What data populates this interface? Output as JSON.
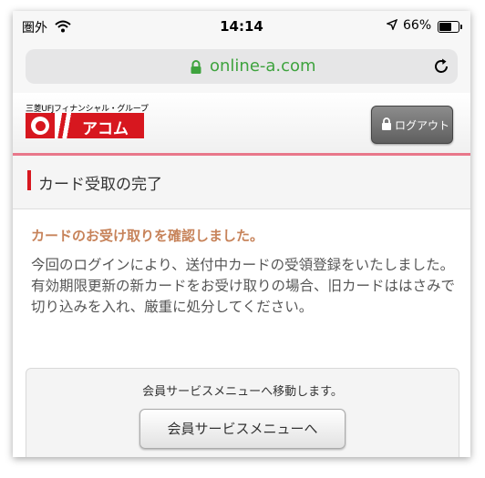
{
  "status_bar": {
    "carrier": "圏外",
    "time": "14:14",
    "battery": "66%",
    "battery_level": 0.66
  },
  "browser": {
    "url": "online-a.com"
  },
  "header": {
    "group_name": "三菱UFJフィナンシャル・グループ",
    "brand": "アコム",
    "logout_label": "ログアウト"
  },
  "section": {
    "title": "カード受取の完了"
  },
  "content": {
    "confirm_message": "カードのお受け取りを確認しました。",
    "body_line1": "今回のログインにより、送付中カードの受領登録をいたしました。",
    "body_line2": "有効期限更新の新カードをお受け取りの場合、旧カードははさみで切り込みを入れ、厳重に処分してください。"
  },
  "member_menu": {
    "message": "会員サービスメニューへ移動します。",
    "button_label": "会員サービスメニューへ"
  },
  "colors": {
    "brand_red": "#d7171f",
    "url_green": "#3ea33e",
    "confirm_text": "#c7835a"
  }
}
